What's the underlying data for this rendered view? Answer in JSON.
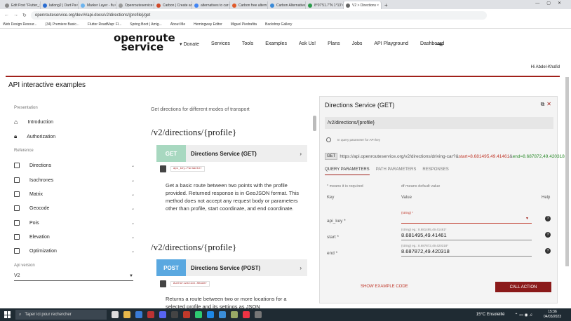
{
  "browser": {
    "tabs": [
      {
        "label": "Edit Post \"Flutter_"
      },
      {
        "label": "latlong2 | Dart Pa"
      },
      {
        "label": "Marker Layer - flu"
      },
      {
        "label": "Openrouteservice"
      },
      {
        "label": "Carbon | Create ar"
      },
      {
        "label": "alternatives to car"
      },
      {
        "label": "Carbon free altern"
      },
      {
        "label": "Carbon Alternative"
      },
      {
        "label": "8°07'51.7\"N 1°13'"
      },
      {
        "label": "V2 > Directions"
      }
    ],
    "url": "openrouteservice.org/dev/#/api-docs/v2/directions/{profile}/get",
    "bookmarks": [
      "Web Design Resour...",
      "(34) Premiere Basic...",
      "Flutter RoadMap: Fl...",
      "Spring Boot | Amig...",
      "About Me",
      "Hemingway Editor",
      "Miguel Piedrafita",
      "Backdrop Gallery"
    ]
  },
  "site": {
    "logo_top": "openroute",
    "logo_bottom": "service",
    "nav": [
      "▾ Donate",
      "Services",
      "Tools",
      "Examples",
      "Ask Us!",
      "Plans",
      "Jobs",
      "API Playground",
      "Dashboard"
    ],
    "greeting": "Hi Abdel-Khafid",
    "section_title": "API interactive examples"
  },
  "sidebar": {
    "presentation_label": "Presentation",
    "reference_label": "Reference",
    "api_version_label": "Api version",
    "api_version_value": "V2",
    "items": [
      {
        "label": "Introduction"
      },
      {
        "label": "Authorization"
      },
      {
        "label": "Directions"
      },
      {
        "label": "Isochrones"
      },
      {
        "label": "Matrix"
      },
      {
        "label": "Geocode"
      },
      {
        "label": "Pois"
      },
      {
        "label": "Elevation"
      },
      {
        "label": "Optimization"
      }
    ]
  },
  "main": {
    "subtitle": "Get directions for different modes of transport",
    "blocks": [
      {
        "heading": "/v2/directions/{profile}",
        "method": "GET",
        "method_color": "#a8d8c0",
        "title": "Directions Service (GET)",
        "auth": "api_key-Parameter",
        "description": "Get a basic route between two points with the profile provided. Returned response is in GeoJSON format. This method does not accept any request body or parameters other than profile, start coordinate, and end coordinate."
      },
      {
        "heading": "/v2/directions/{profile}",
        "method": "POST",
        "method_color": "#5aa8e0",
        "title": "Directions Service (POST)",
        "auth": "Authorization-Header",
        "description": "Returns a route between two or more locations for a selected profile and its settings as JSON"
      }
    ]
  },
  "panel": {
    "title": "Directions Service (GET)",
    "path": "/v2/directions/{profile}",
    "note": "In query parameter for API key",
    "method": "GET",
    "url_base": "https://api.openrouteservice.org/v2/directions/driving-car?&",
    "url_start": "start=8.681495,49.41461",
    "url_amp": "&",
    "url_end": "end=8.687872,49.420318",
    "tabs": [
      "QUERY PARAMETERS",
      "PATH PARAMETERS",
      "RESPONSES"
    ],
    "required_note": "* means it is required",
    "default_note": "df means default value",
    "col_key": "Key",
    "col_value": "Value",
    "col_help": "Help",
    "params": [
      {
        "key": "api_key *",
        "hint": "(string) *",
        "value": ""
      },
      {
        "key": "start *",
        "hint": "(string) eg.: 8.681495,49.41461*",
        "value": "8.681495,49.41461"
      },
      {
        "key": "end *",
        "hint": "(string) eg.: 8.687872,49.420318*",
        "value": "8.687872,49.420318"
      }
    ],
    "show_example": "SHOW EXAMPLE CODE",
    "call_action": "CALL ACTION"
  },
  "taskbar": {
    "search_placeholder": "Taper ici pour rechercher",
    "weather": "15°C  Ensoleillé",
    "time": "15:36",
    "date": "04/03/2023"
  }
}
